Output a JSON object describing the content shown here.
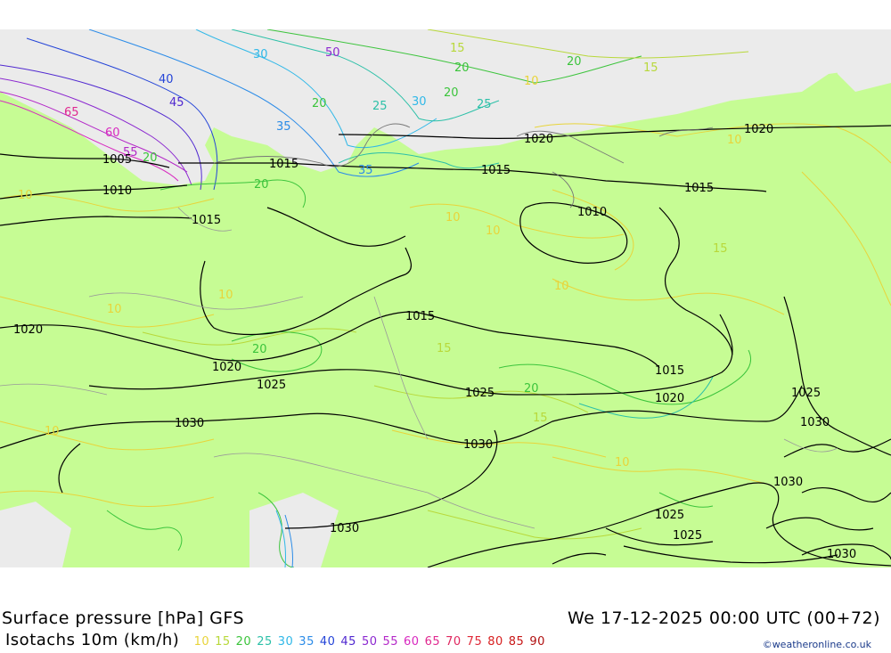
{
  "title": "Surface pressure [hPa] GFS",
  "datetime": "We 17-12-2025 00:00 UTC (00+72)",
  "legend_label": "Isotachs 10m (km/h)",
  "legend_values": [
    {
      "v": "10",
      "color": "#e8d43a"
    },
    {
      "v": "15",
      "color": "#b8d83a"
    },
    {
      "v": "20",
      "color": "#3cc43c"
    },
    {
      "v": "25",
      "color": "#2cc0a8"
    },
    {
      "v": "30",
      "color": "#30b8e8"
    },
    {
      "v": "35",
      "color": "#2c8ce8"
    },
    {
      "v": "40",
      "color": "#2444d8"
    },
    {
      "v": "45",
      "color": "#5028d0"
    },
    {
      "v": "50",
      "color": "#8c28d0"
    },
    {
      "v": "55",
      "color": "#b428c8"
    },
    {
      "v": "60",
      "color": "#d828c0"
    },
    {
      "v": "65",
      "color": "#e02890"
    },
    {
      "v": "70",
      "color": "#e02860"
    },
    {
      "v": "75",
      "color": "#e02838"
    },
    {
      "v": "80",
      "color": "#d82020"
    },
    {
      "v": "85",
      "color": "#c81818"
    },
    {
      "v": "90",
      "color": "#b01010"
    }
  ],
  "credit": "©weatheronline.co.uk",
  "isobar_labels": [
    "1005",
    "1010",
    "1015",
    "1015",
    "1015",
    "1015",
    "1020",
    "1020",
    "1010",
    "1015",
    "1015",
    "1020",
    "1020",
    "1025",
    "1025",
    "1020",
    "1025",
    "1030",
    "1030",
    "1030",
    "1025",
    "1025",
    "1030",
    "1030",
    "1030"
  ],
  "isotach_labels": [
    "65",
    "60",
    "55",
    "20",
    "45",
    "40",
    "30",
    "35",
    "50",
    "20",
    "25",
    "15",
    "20",
    "15",
    "10",
    "10",
    "15",
    "10",
    "20",
    "10",
    "20",
    "25",
    "30",
    "35",
    "20",
    "10",
    "10",
    "10",
    "10",
    "15",
    "20",
    "10",
    "15",
    "20",
    "10"
  ]
}
